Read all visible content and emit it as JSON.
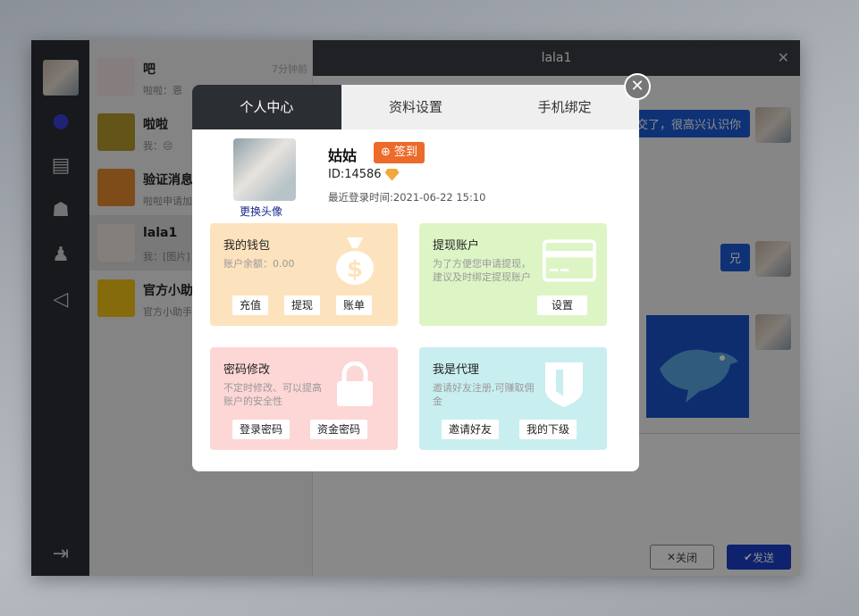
{
  "chat_list": {
    "items": [
      {
        "name": "吧",
        "msg": "啦啦：恩",
        "time": "7分钟前"
      },
      {
        "name": "啦啦",
        "msg": "我：😔",
        "time": ""
      },
      {
        "name": "验证消息",
        "msg": "啦啦申请加",
        "time": ""
      },
      {
        "name": "lala1",
        "msg": "我：[图片]",
        "time": ""
      },
      {
        "name": "官方小助",
        "msg": "官方小助手",
        "time": ""
      }
    ]
  },
  "chat": {
    "title": "lala1",
    "bubble1": "交了，很高兴认识你",
    "bubble2": "兄",
    "close_label": "关闭",
    "send_label": "发送"
  },
  "modal": {
    "tabs": [
      "个人中心",
      "资料设置",
      "手机绑定"
    ],
    "change_avatar": "更换头像",
    "username": "姑姑",
    "sign_label": "签到",
    "user_id": "ID:14586",
    "last_login": "最近登录时间:2021-06-22 15:10",
    "cards": {
      "wallet": {
        "title": "我的钱包",
        "desc": "账户余额：0.00",
        "buttons": [
          "充值",
          "提现",
          "账单"
        ],
        "color": "#fde3bd"
      },
      "withdraw": {
        "title": "提现账户",
        "desc": "为了方便您申请提现，建议及时绑定提现账户",
        "buttons": [
          "设置"
        ],
        "color": "#ddf5c5"
      },
      "password": {
        "title": "密码修改",
        "desc": "不定时修改、可以提高账户的安全性",
        "buttons": [
          "登录密码",
          "资金密码"
        ],
        "color": "#fdd6d6"
      },
      "agent": {
        "title": "我是代理",
        "desc": "邀请好友注册,可赚取佣金",
        "buttons": [
          "邀请好友",
          "我的下级"
        ],
        "color": "#c9eef0"
      }
    }
  }
}
